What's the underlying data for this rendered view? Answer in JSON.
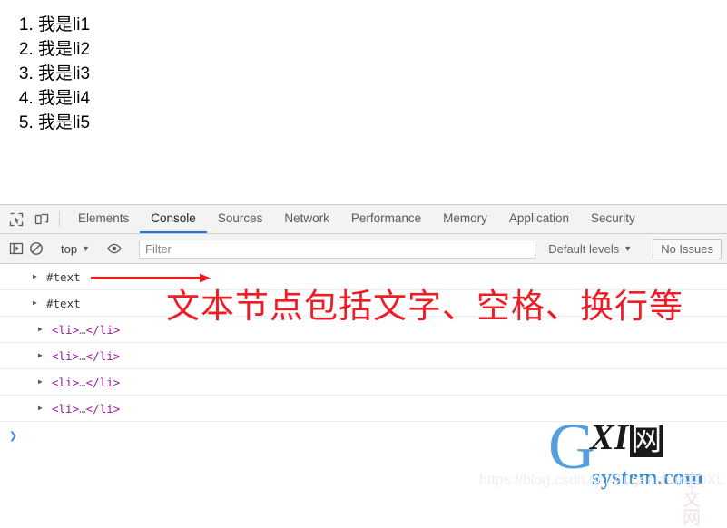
{
  "page": {
    "list_items": [
      "我是li1",
      "我是li2",
      "我是li3",
      "我是li4",
      "我是li5"
    ]
  },
  "devtools": {
    "toolbar_icons": [
      {
        "name": "inspect-element-icon",
        "glyph": "inspect"
      },
      {
        "name": "device-toolbar-icon",
        "glyph": "device"
      }
    ],
    "tabs": [
      {
        "label": "Elements",
        "active": false
      },
      {
        "label": "Console",
        "active": true
      },
      {
        "label": "Sources",
        "active": false
      },
      {
        "label": "Network",
        "active": false
      },
      {
        "label": "Performance",
        "active": false
      },
      {
        "label": "Memory",
        "active": false
      },
      {
        "label": "Application",
        "active": false
      },
      {
        "label": "Security",
        "active": false
      }
    ],
    "filterbar": {
      "sidebar_toggle_icon": "sidebar-toggle-icon",
      "clear_console_icon": "clear-console-icon",
      "context_value": "top",
      "context_caret": "▼",
      "eye_icon": "live-expression-eye-icon",
      "filter_value": "",
      "filter_placeholder": "Filter",
      "levels_value": "Default levels",
      "levels_caret": "▼",
      "issues_label": "No Issues"
    },
    "console_rows": [
      {
        "type": "text-node",
        "disclosure": "▶",
        "label": "#text"
      },
      {
        "type": "text-node",
        "disclosure": "▶",
        "label": "#text"
      },
      {
        "type": "element-node",
        "disclosure": "▶",
        "open": "<li>",
        "ellipsis": "…",
        "close": "</li>"
      },
      {
        "type": "element-node",
        "disclosure": "▶",
        "open": "<li>",
        "ellipsis": "…",
        "close": "</li>"
      },
      {
        "type": "element-node",
        "disclosure": "▶",
        "open": "<li>",
        "ellipsis": "…",
        "close": "</li>"
      },
      {
        "type": "element-node",
        "disclosure": "▶",
        "open": "<li>",
        "ellipsis": "…",
        "close": "</li>"
      }
    ],
    "prompt_caret": "❯"
  },
  "annotation": {
    "text": "文本节点包括文字、空格、换行等",
    "color": "#ee1c25",
    "arrow_color": "#f01a22"
  },
  "watermark": {
    "logo_g": "G",
    "logo_xi": "XI",
    "logo_cn": "网",
    "domain": "system.com",
    "ghost_cn": "中文网",
    "url": "https://blog.csdn.net/Augenstern_QXL"
  },
  "colors": {
    "accent": "#1a73e8",
    "tag": "#a019a0",
    "toolbar_bg": "#f3f3f3",
    "prompt": "#4285f4"
  }
}
